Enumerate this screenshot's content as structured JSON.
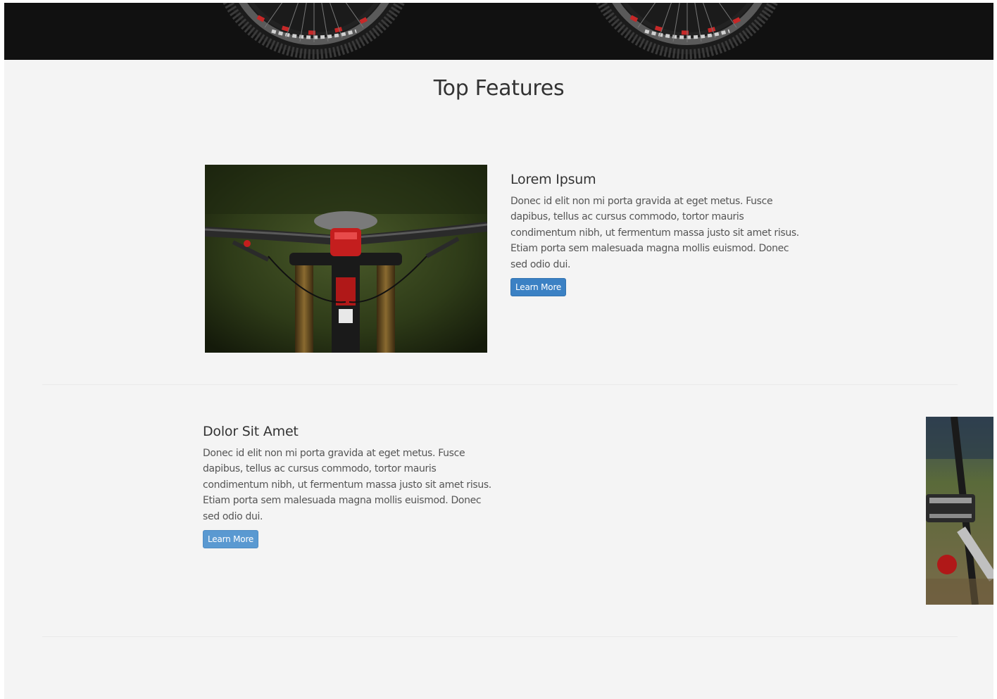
{
  "section_title": "Top Features",
  "features": [
    {
      "heading": "Lorem Ipsum",
      "body": "Donec id elit non mi porta gravida at eget metus. Fusce dapibus, tellus ac cursus commodo, tortor mauris condimentum nibh, ut fermentum massa justo sit amet risus. Etiam porta sem malesuada magna mollis euismod. Donec sed odio dui.",
      "button_label": "Learn More"
    },
    {
      "heading": "Dolor Sit Amet",
      "body": "Donec id elit non mi porta gravida at eget metus. Fusce dapibus, tellus ac cursus commodo, tortor mauris condimentum nibh, ut fermentum massa justo sit amet risus. Etiam porta sem malesuada magna mollis euismod. Donec sed odio dui.",
      "button_label": "Learn More"
    }
  ],
  "colors": {
    "background": "#f4f4f4",
    "hero_background": "#111111",
    "button_primary": "#3b81c4",
    "button_secondary": "#5a99d1",
    "heading_text": "#333333",
    "body_text": "#555555"
  }
}
